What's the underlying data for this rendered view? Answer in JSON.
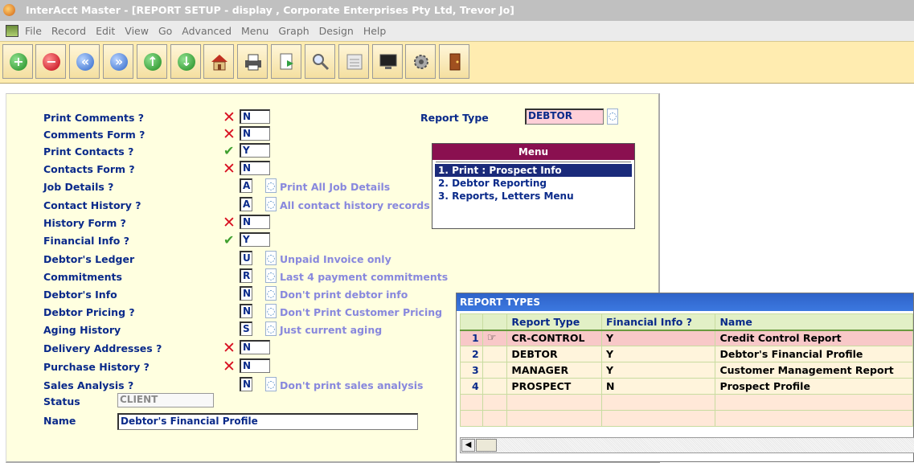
{
  "window": {
    "title": "InterAcct Master - [REPORT SETUP - display , Corporate Enterprises Pty Ltd, Trevor Jo]"
  },
  "menubar": {
    "items": [
      "File",
      "Record",
      "Edit",
      "View",
      "Go",
      "Advanced",
      "Menu",
      "Graph",
      "Design",
      "Help"
    ]
  },
  "toolbar": {
    "buttons": [
      "add-icon",
      "delete-icon",
      "previous-icon",
      "next-icon",
      "up-icon",
      "down-icon",
      "home-icon",
      "print-icon",
      "export-icon",
      "search-icon",
      "binary-icon",
      "monitor-icon",
      "settings-icon",
      "exit-door-icon"
    ]
  },
  "form": {
    "fields": [
      {
        "label": "Print Comments ?",
        "value": "N",
        "mark": "x"
      },
      {
        "label": "Comments Form ?",
        "value": "N",
        "mark": "x"
      },
      {
        "label": "Print Contacts ?",
        "value": "Y",
        "mark": "tick"
      },
      {
        "label": "Contacts Form ?",
        "value": "N",
        "mark": "x"
      },
      {
        "label": "Job Details ?",
        "value": "A",
        "desc": "Print All Job Details"
      },
      {
        "label": "Contact History ?",
        "value": "A",
        "desc": "All contact history records"
      },
      {
        "label": "History Form ?",
        "value": "N",
        "mark": "x"
      },
      {
        "label": "Financial Info ?",
        "value": "Y",
        "mark": "tick"
      },
      {
        "label": "Debtor's Ledger",
        "value": "U",
        "desc": "Unpaid Invoice only"
      },
      {
        "label": "Commitments",
        "value": "R",
        "desc": "Last 4 payment commitments"
      },
      {
        "label": "Debtor's Info",
        "value": "N",
        "desc": "Don't print debtor info"
      },
      {
        "label": "Debtor Pricing ?",
        "value": "N",
        "desc": "Don't Print Customer Pricing"
      },
      {
        "label": "Aging History",
        "value": "S",
        "desc": "Just current aging"
      },
      {
        "label": "Delivery Addresses ?",
        "value": "N",
        "mark": "x"
      },
      {
        "label": "Purchase History ?",
        "value": "N",
        "mark": "x"
      },
      {
        "label": "Sales Analysis ?",
        "value": "N",
        "desc": "Don't print sales analysis"
      }
    ],
    "status_label": "Status",
    "status_value": "CLIENT",
    "name_label": "Name",
    "name_value": "Debtor's Financial Profile",
    "report_type_label": "Report Type",
    "report_type_value": "DEBTOR"
  },
  "menu": {
    "title": "Menu",
    "items": [
      "1. Print : Prospect Info",
      "2. Debtor Reporting",
      "3. Reports, Letters Menu"
    ]
  },
  "report_types": {
    "title": "REPORT TYPES",
    "columns": [
      "Report Type",
      "Financial Info ?",
      "Name"
    ],
    "rows": [
      {
        "num": "1",
        "type": "CR-CONTROL",
        "fin": "Y",
        "name": "Credit Control Report"
      },
      {
        "num": "2",
        "type": "DEBTOR",
        "fin": "Y",
        "name": "Debtor's Financial Profile"
      },
      {
        "num": "3",
        "type": "MANAGER",
        "fin": "Y",
        "name": "Customer Management Report"
      },
      {
        "num": "4",
        "type": "PROSPECT",
        "fin": "N",
        "name": "Prospect Profile"
      }
    ]
  }
}
